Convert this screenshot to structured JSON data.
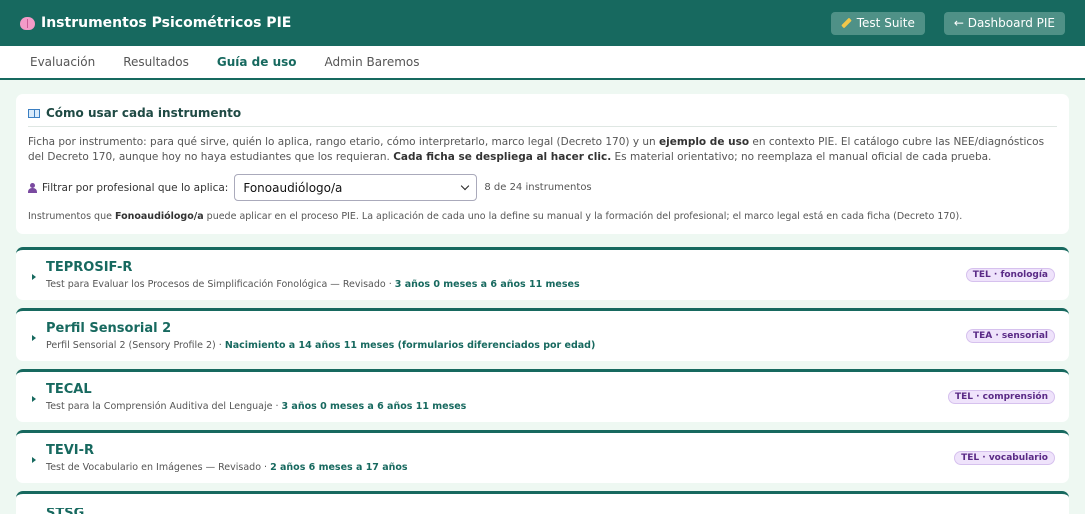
{
  "header": {
    "title": "Instrumentos Psicométricos PIE",
    "test_suite_label": "Test Suite",
    "dashboard_label": "← Dashboard PIE"
  },
  "tabs": [
    {
      "label": "Evaluación",
      "active": false
    },
    {
      "label": "Resultados",
      "active": false
    },
    {
      "label": "Guía de uso",
      "active": true
    },
    {
      "label": "Admin Baremos",
      "active": false
    }
  ],
  "guide": {
    "title": "Cómo usar cada instrumento",
    "desc_1": "Ficha por instrumento: para qué sirve, quién lo aplica, rango etario, cómo interpretarlo, marco legal (Decreto 170) y un ",
    "desc_bold_1": "ejemplo de uso",
    "desc_2": " en contexto PIE. El catálogo cubre las NEE/diagnósticos del Decreto 170, aunque hoy no haya estudiantes que los requieran. ",
    "desc_bold_2": "Cada ficha se despliega al hacer clic.",
    "desc_3": " Es material orientativo; no reemplaza el manual oficial de cada prueba.",
    "filter_label": "Filtrar por profesional que lo aplica:",
    "filter_value": "Fonoaudiólogo/a",
    "count": "8 de 24 instrumentos",
    "note_1": "Instrumentos que ",
    "note_bold": "Fonoaudiólogo/a",
    "note_2": " puede aplicar en el proceso PIE. La aplicación de cada uno la define su manual y la formación del profesional; el marco legal está en cada ficha (Decreto 170)."
  },
  "instruments": [
    {
      "name": "TEPROSIF-R",
      "full_name": "Test para Evaluar los Procesos de Simplificación Fonológica — Revisado · ",
      "age": "3 años 0 meses a 6 años 11 meses",
      "badge": "TEL · fonología"
    },
    {
      "name": "Perfil Sensorial 2",
      "full_name": "Perfil Sensorial 2 (Sensory Profile 2) · ",
      "age": "Nacimiento a 14 años 11 meses (formularios diferenciados por edad)",
      "badge": "TEA · sensorial"
    },
    {
      "name": "TECAL",
      "full_name": "Test para la Comprensión Auditiva del Lenguaje · ",
      "age": "3 años 0 meses a 6 años 11 meses",
      "badge": "TEL · comprensión"
    },
    {
      "name": "TEVI-R",
      "full_name": "Test de Vocabulario en Imágenes — Revisado · ",
      "age": "2 años 6 meses a 17 años",
      "badge": "TEL · vocabulario"
    },
    {
      "name": "STSG",
      "full_name": "",
      "age": "",
      "badge": ""
    }
  ]
}
